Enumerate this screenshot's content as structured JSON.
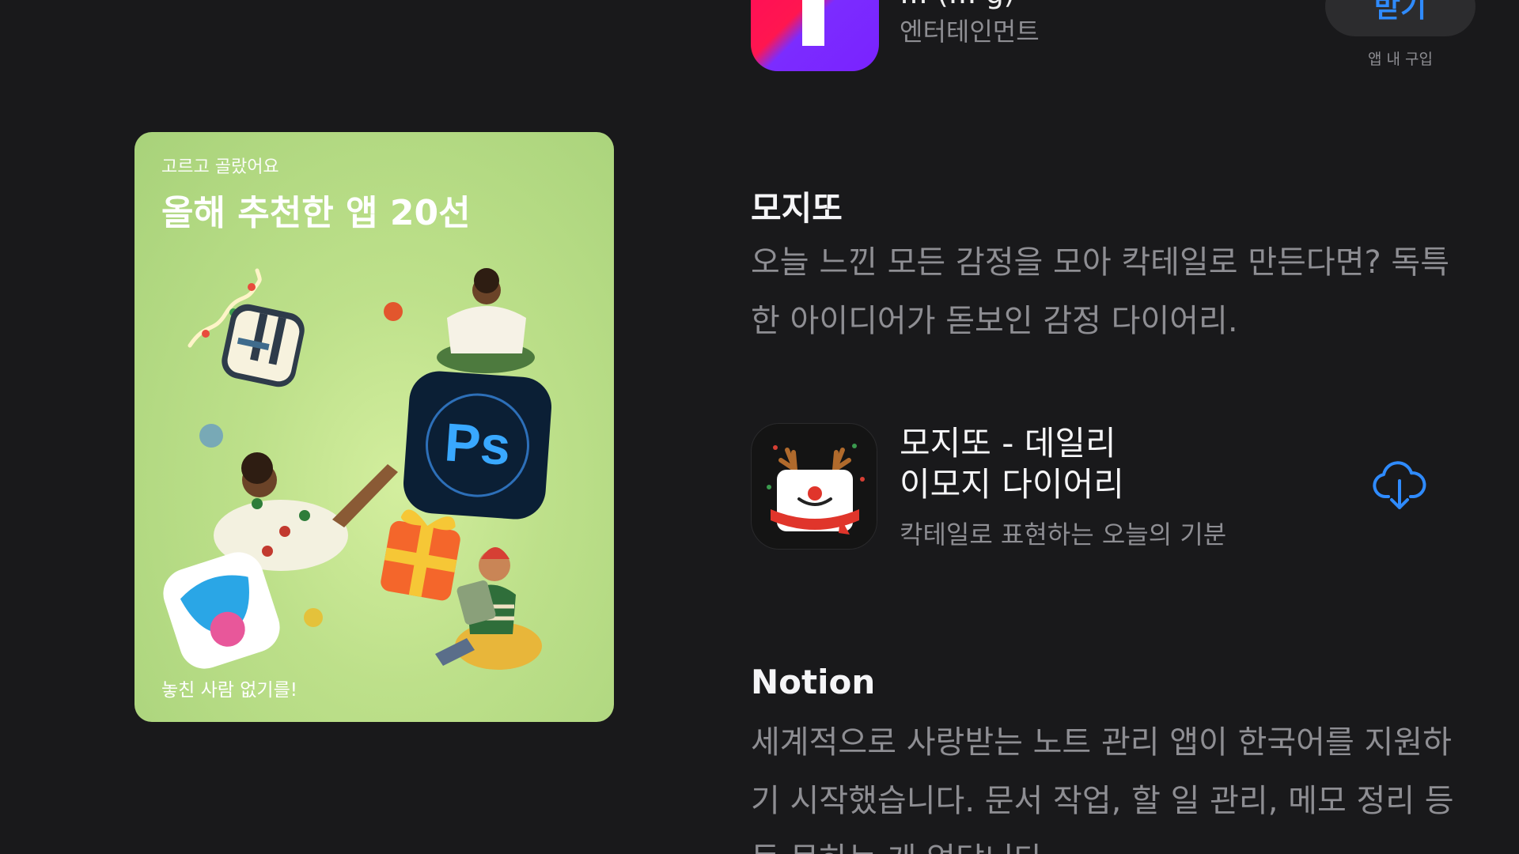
{
  "top_app": {
    "title": "… (… g)",
    "category": "엔터테인먼트",
    "get_button_label": "받기",
    "in_app_purchase_label": "앱 내 구입"
  },
  "promo_card": {
    "eyebrow": "고르고 골랐어요",
    "title": "올해 추천한 앱 20선",
    "footer": "놓친 사람 없기를!",
    "ps_icon_text": "Ps",
    "background_color": "#bde08a"
  },
  "mojitto_section": {
    "heading": "모지또",
    "description": "오늘 느낀 모든 감정을 모아 칵테일로 만든다면? 독특한 아이디어가 돋보인 감정 다이어리."
  },
  "mojitto_app": {
    "title_line1": "모지또 - 데일리",
    "title_line2": "이모지 다이어리",
    "subtitle": "칵테일로 표현하는 오늘의 기분",
    "action_icon": "cloud-download-icon",
    "accent_color": "#2f8bff"
  },
  "notion_section": {
    "heading": "Notion",
    "description": "세계적으로 사랑받는 노트 관리 앱이 한국어를 지원하기 시작했습니다. 문서 작업, 할 일 관리, 메모 정리 등등 못하는 게 없답니다."
  }
}
